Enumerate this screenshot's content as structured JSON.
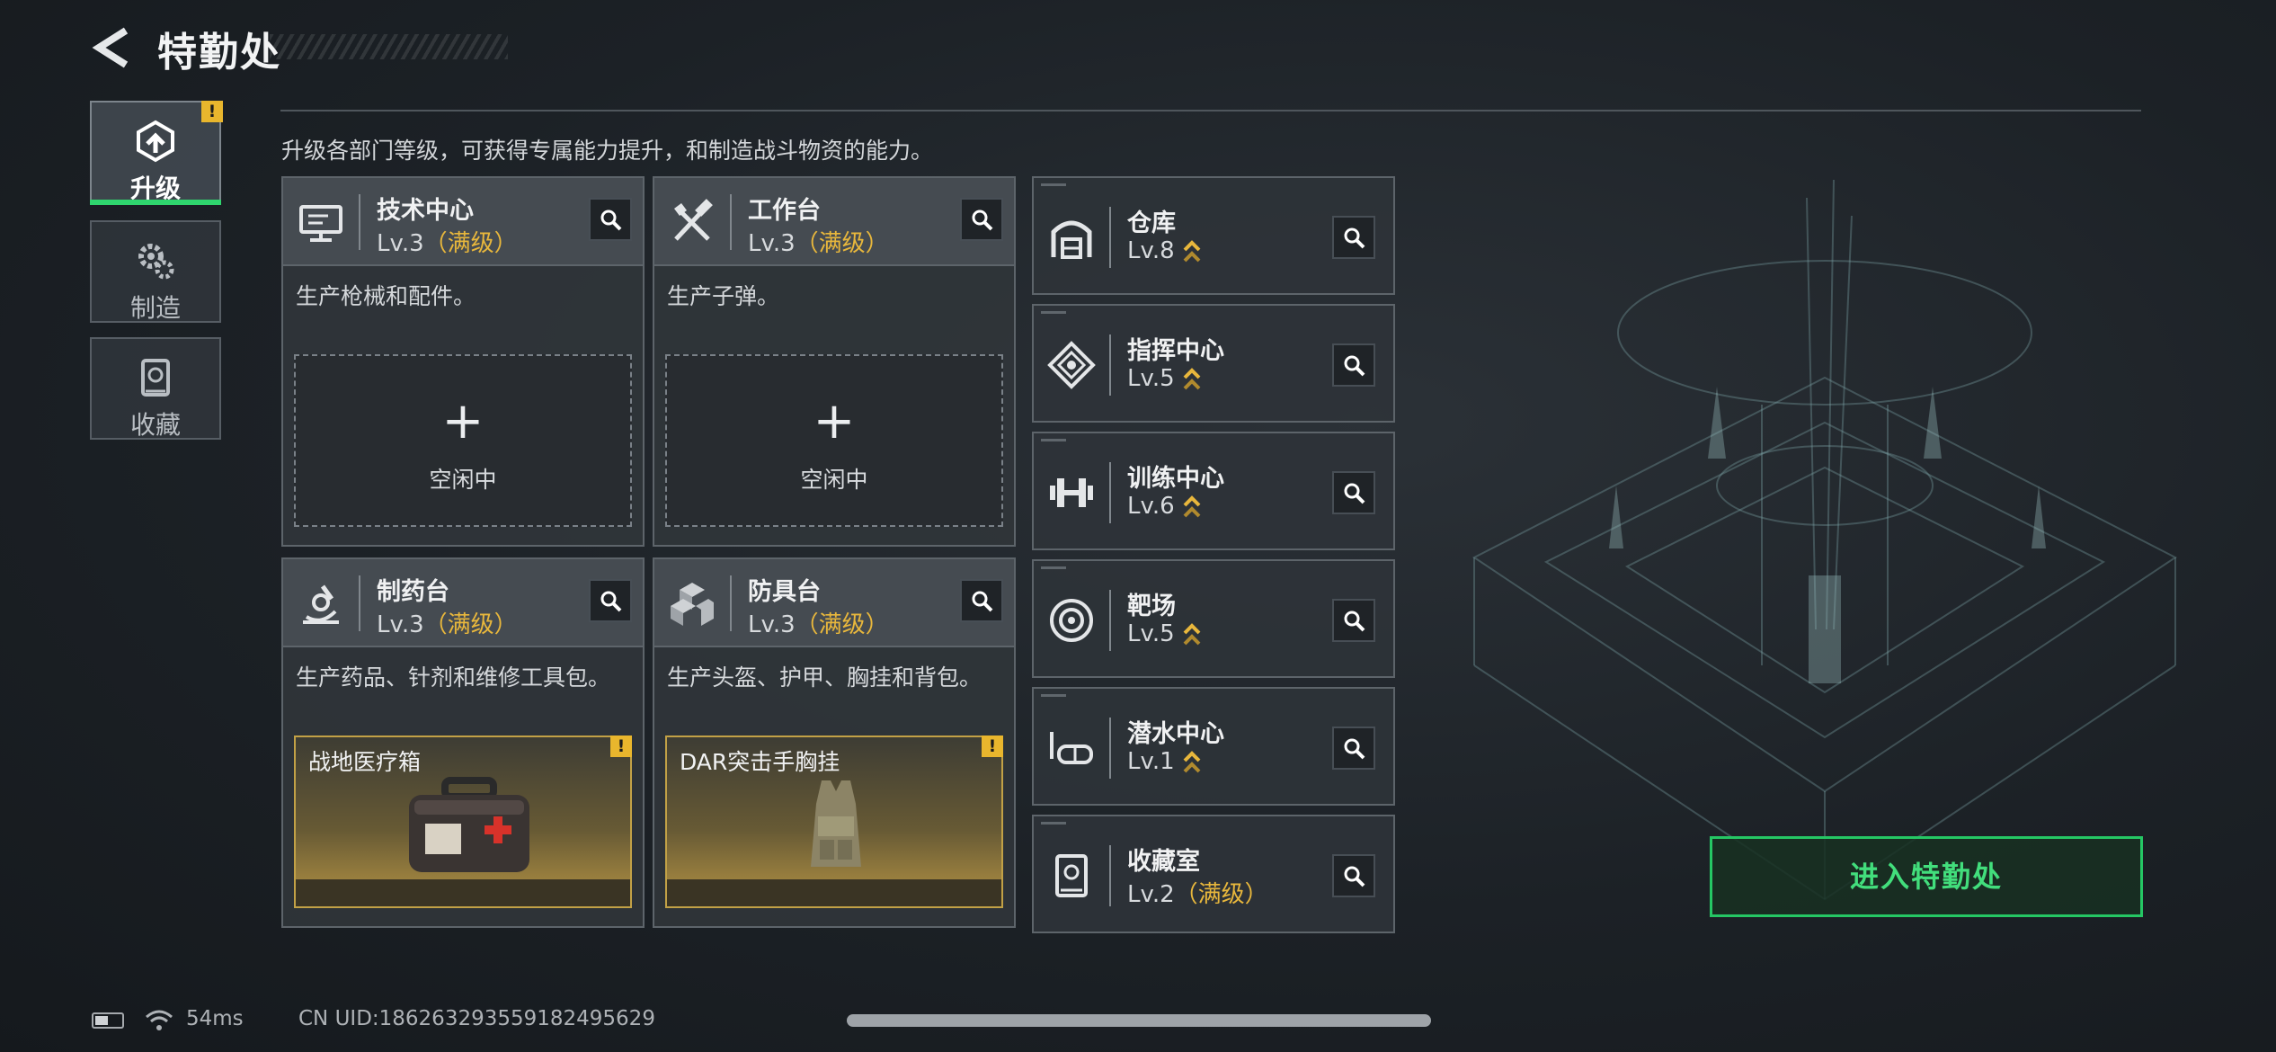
{
  "header": {
    "title": "特勤处",
    "back_icon": "back-arrow-icon"
  },
  "nav": [
    {
      "label": "升级",
      "icon": "upgrade-icon",
      "active": true,
      "alert": "!"
    },
    {
      "label": "制造",
      "icon": "gears-icon",
      "active": false
    },
    {
      "label": "收藏",
      "icon": "collection-icon",
      "active": false
    }
  ],
  "description": "升级各部门等级，可获得专属能力提升，和制造战斗物资的能力。",
  "departments": [
    {
      "name": "技术中心",
      "level": "Lv.3",
      "max": "（满级）",
      "desc": "生产枪械和配件。",
      "idle_label": "空闲中",
      "icon": "tech-center-icon"
    },
    {
      "name": "工作台",
      "level": "Lv.3",
      "max": "（满级）",
      "desc": "生产子弹。",
      "idle_label": "空闲中",
      "icon": "workbench-icon"
    },
    {
      "name": "制药台",
      "level": "Lv.3",
      "max": "（满级）",
      "desc": "生产药品、针剂和维修工具包。",
      "item": "战地医疗箱",
      "item_alert": "!",
      "icon": "pharmacy-icon"
    },
    {
      "name": "防具台",
      "level": "Lv.3",
      "max": "（满级）",
      "desc": "生产头盔、护甲、胸挂和背包。",
      "item": "DAR突击手胸挂",
      "item_alert": "!",
      "icon": "armor-bench-icon"
    }
  ],
  "facilities": [
    {
      "name": "仓库",
      "level": "Lv.8",
      "icon": "warehouse-icon"
    },
    {
      "name": "指挥中心",
      "level": "Lv.5",
      "icon": "command-center-icon"
    },
    {
      "name": "训练中心",
      "level": "Lv.6",
      "icon": "training-center-icon"
    },
    {
      "name": "靶场",
      "level": "Lv.5",
      "icon": "shooting-range-icon"
    },
    {
      "name": "潜水中心",
      "level": "Lv.1",
      "icon": "diving-center-icon"
    },
    {
      "name": "收藏室",
      "level": "Lv.2",
      "max": "（满级）",
      "icon": "collection-room-icon"
    }
  ],
  "enter_button": "进入特勤处",
  "status": {
    "ping": "54ms",
    "uid": "CN UID:1862632935591824956​29"
  },
  "colors": {
    "accent_green": "#2fd56e",
    "max_level_gold": "#e8b73c"
  }
}
